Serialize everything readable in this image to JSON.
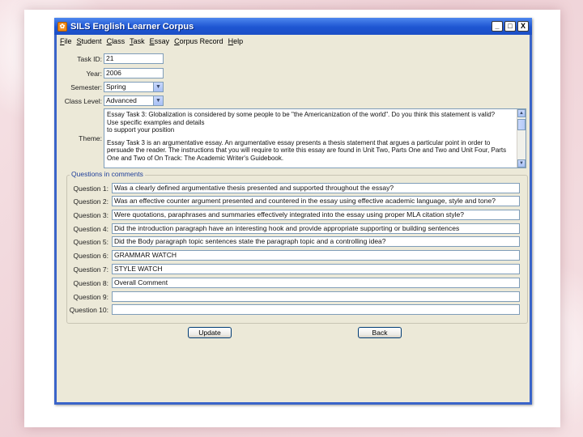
{
  "window": {
    "title": "SILS English Learner Corpus",
    "controls": [
      "_",
      "□",
      "X"
    ]
  },
  "menu": [
    "File",
    "Student",
    "Class",
    "Task",
    "Essay",
    "Corpus Record",
    "Help"
  ],
  "form": {
    "task_id": {
      "label": "Task ID:",
      "value": "21"
    },
    "year": {
      "label": "Year:",
      "value": "2006"
    },
    "semester": {
      "label": "Semester:",
      "value": "Spring"
    },
    "class_level": {
      "label": "Class Level:",
      "value": "Advanced"
    },
    "theme": {
      "label": "Theme:",
      "paragraph1": "Essay Task 3: Globalization is considered by some people to be \"the Americanization of the world\". Do you think this statement is valid?\nUse specific examples and details\nto support your position",
      "paragraph2": "Essay Task 3 is an argumentative essay. An argumentative essay presents a thesis statement that argues a particular point in order to persuade the reader. The instructions that you will require to write this essay are found in Unit Two, Parts One and Two and Unit Four, Parts One and Two of On Track: The Academic Writer's Guidebook."
    }
  },
  "questions_group": {
    "legend": "Questions in comments",
    "items": [
      {
        "label": "Question 1:",
        "value": "Was a clearly defined argumentative thesis presented and supported throughout the essay?"
      },
      {
        "label": "Question 2:",
        "value": "Was an effective counter argument presented and countered in the essay using effective academic language, style and tone?"
      },
      {
        "label": "Question 3:",
        "value": "Were quotations, paraphrases and summaries effectively integrated into the essay using proper MLA citation style?"
      },
      {
        "label": "Question 4:",
        "value": "Did the introduction paragraph have an interesting hook and provide appropriate supporting or building sentences"
      },
      {
        "label": "Question 5:",
        "value": "Did the Body paragraph topic sentences state the paragraph topic and a controlling idea?"
      },
      {
        "label": "Question 6:",
        "value": "GRAMMAR WATCH"
      },
      {
        "label": "Question 7:",
        "value": "STYLE WATCH"
      },
      {
        "label": "Question 8:",
        "value": "Overall Comment"
      },
      {
        "label": "Question 9:",
        "value": ""
      },
      {
        "label": "Question 10:",
        "value": ""
      }
    ]
  },
  "buttons": {
    "update": "Update",
    "back": "Back"
  }
}
